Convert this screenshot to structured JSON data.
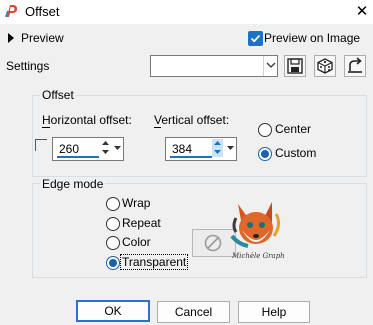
{
  "window": {
    "title": "Offset",
    "close_glyph": "✕"
  },
  "preview": {
    "label": "Preview",
    "preview_on_image_label": "Preview on Image",
    "preview_on_image_checked": true
  },
  "settings": {
    "label": "Settings",
    "preset_value": ""
  },
  "offset_group": {
    "title": "Offset",
    "horizontal_label": "Horizontal offset:",
    "horizontal_value": "260",
    "vertical_label": "Vertical offset:",
    "vertical_value": "384",
    "center_label": "Center",
    "custom_label": "Custom",
    "selected": "Custom"
  },
  "edge_group": {
    "title": "Edge mode",
    "options": [
      "Wrap",
      "Repeat",
      "Color",
      "Transparent"
    ],
    "selected": "Transparent"
  },
  "watermark_text": "Michèle Graph",
  "buttons": {
    "ok": "OK",
    "cancel": "Cancel",
    "help": "Help"
  },
  "colors": {
    "accent": "#1a73c7",
    "radio_selected": "#1a5fb4"
  }
}
